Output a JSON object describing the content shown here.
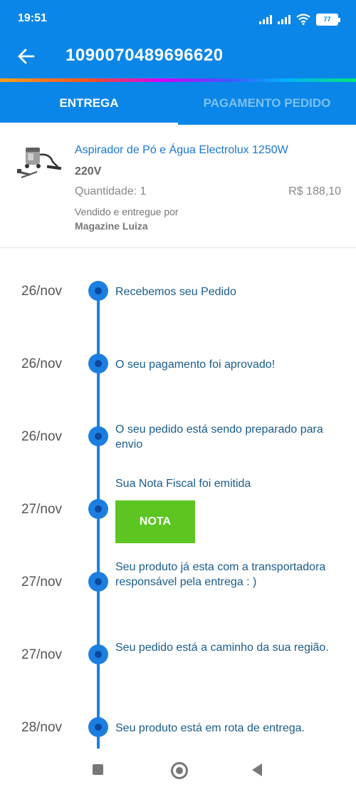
{
  "status_bar": {
    "time": "19:51",
    "battery": "77",
    "icons": [
      "signal-icon",
      "signal-icon",
      "wifi-icon",
      "battery-icon"
    ]
  },
  "app_bar": {
    "title": "1090070489696620",
    "back_icon": "arrow-left-icon"
  },
  "tabs": [
    {
      "label": "ENTREGA",
      "active": true
    },
    {
      "label": "PAGAMENTO PEDIDO",
      "active": false
    }
  ],
  "product": {
    "name": "Aspirador de Pó e Água Electrolux 1250W",
    "voltage": "220V",
    "quantity": "Quantidade: 1",
    "price": "R$ 188,10",
    "seller_label": "Vendido e entregue por",
    "seller_name": "Magazine Luiza"
  },
  "timeline": [
    {
      "date": "26/nov",
      "text": "Recebemos seu Pedido"
    },
    {
      "date": "26/nov",
      "text": "O seu pagamento foi aprovado!"
    },
    {
      "date": "26/nov",
      "text": "O seu pedido está sendo preparado para envio"
    },
    {
      "date": "27/nov",
      "text": "Sua Nota Fiscal foi emitida",
      "button": "NOTA"
    },
    {
      "date": "27/nov",
      "text": "Seu produto já esta com a transportadora responsável pela entrega : )"
    },
    {
      "date": "27/nov",
      "text": "Seu pedido está a caminho da sua região."
    },
    {
      "date": "28/nov",
      "text": "Seu produto está em rota de entrega."
    }
  ],
  "colors": {
    "primary": "#0a86e8",
    "timeline": "#1c7fe0",
    "nota_button": "#5dc521"
  },
  "nav_bar": {
    "icons": [
      "recents-square-icon",
      "home-circle-icon",
      "back-triangle-icon"
    ]
  }
}
